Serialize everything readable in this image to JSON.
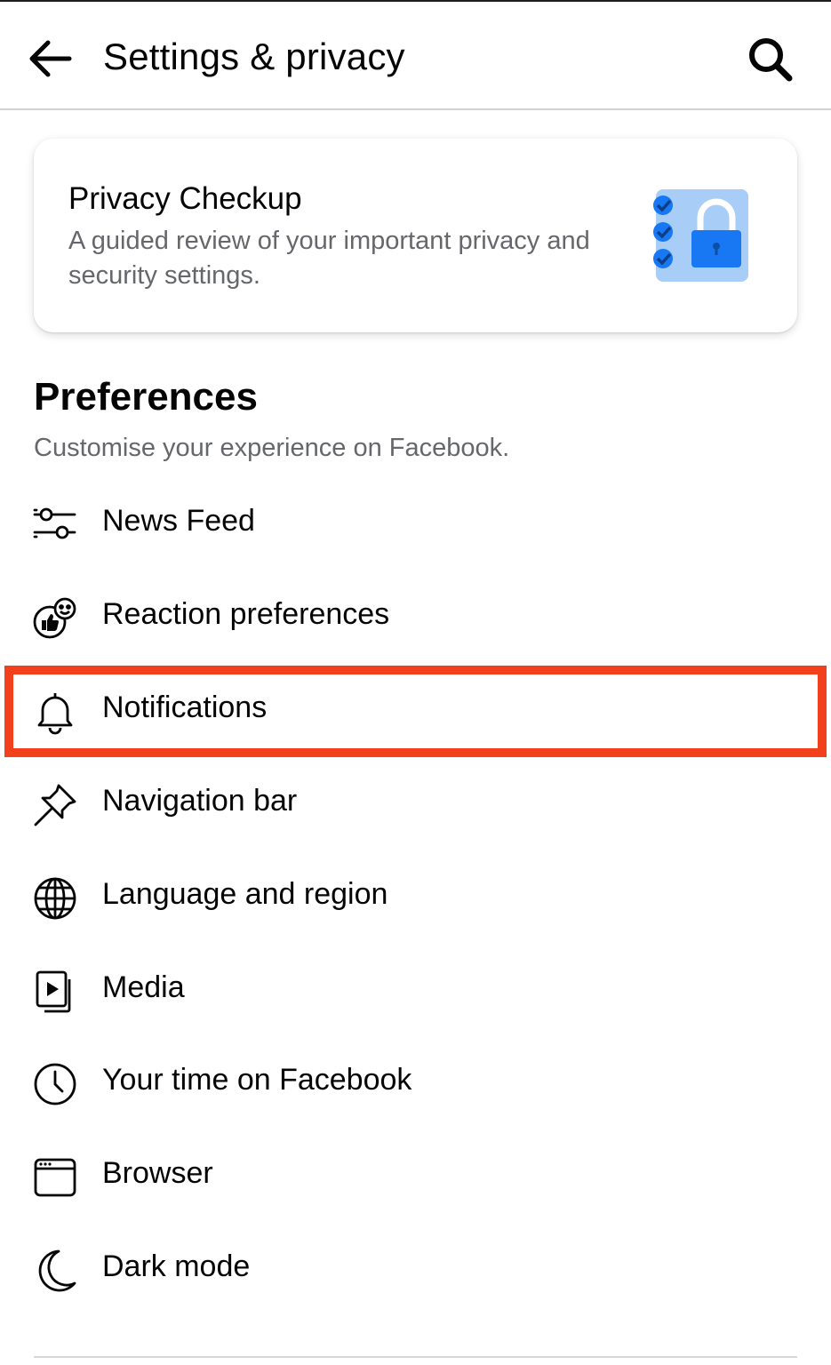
{
  "header": {
    "title": "Settings & privacy",
    "back_icon": "arrow-left-icon",
    "search_icon": "search-icon"
  },
  "privacy_card": {
    "title": "Privacy Checkup",
    "description": "A guided review of your important privacy and security settings.",
    "illustration": "privacy-checklist-lock-icon"
  },
  "preferences": {
    "title": "Preferences",
    "subtitle": "Customise your experience on Facebook.",
    "items": [
      {
        "label": "News Feed",
        "icon": "sliders-icon"
      },
      {
        "label": "Reaction preferences",
        "icon": "reaction-icon"
      },
      {
        "label": "Notifications",
        "icon": "bell-icon",
        "highlighted": true
      },
      {
        "label": "Navigation bar",
        "icon": "pin-icon"
      },
      {
        "label": "Language and region",
        "icon": "globe-icon"
      },
      {
        "label": "Media",
        "icon": "media-icon"
      },
      {
        "label": "Your time on Facebook",
        "icon": "clock-icon"
      },
      {
        "label": "Browser",
        "icon": "browser-icon"
      },
      {
        "label": "Dark mode",
        "icon": "moon-icon"
      }
    ]
  },
  "colors": {
    "highlight": "#f2401d",
    "brand_blue": "#1877f2",
    "text_primary": "#050505",
    "text_secondary": "#65676b"
  }
}
